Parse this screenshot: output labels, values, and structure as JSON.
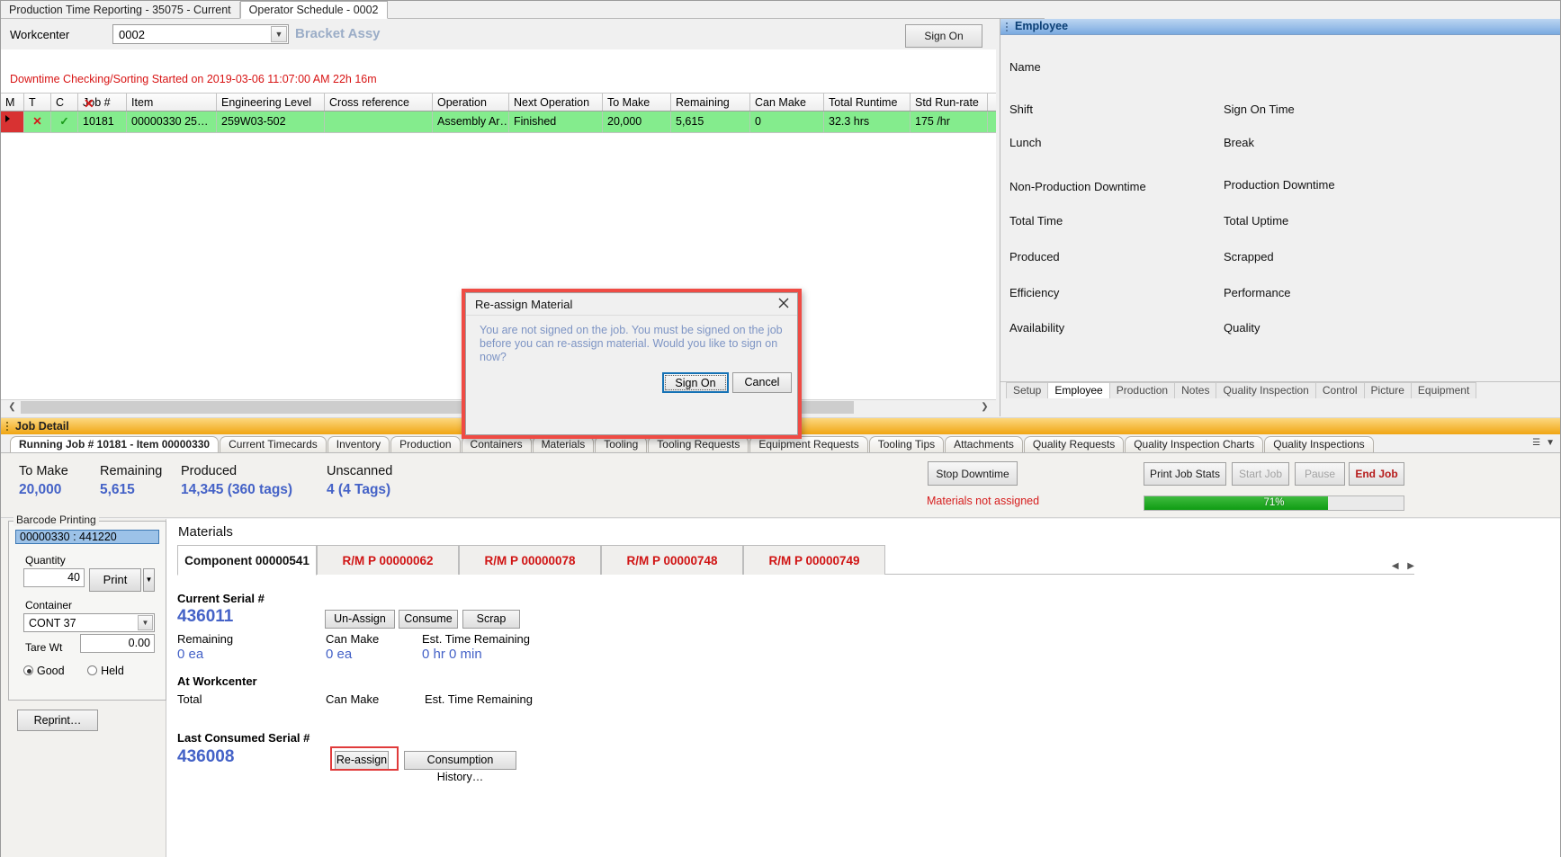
{
  "window": {
    "close_icon": "close-icon"
  },
  "top_tabs": [
    {
      "label": "Production Time Reporting - 35075 - Current",
      "active": false
    },
    {
      "label": "Operator Schedule - 0002",
      "active": true
    }
  ],
  "workcenter": {
    "label": "Workcenter",
    "value": "0002",
    "description": "Bracket Assy",
    "sign_on_button": "Sign On",
    "downtime_message": "Downtime Checking/Sorting Started on 2019-03-06 11:07:00 AM 22h 16m"
  },
  "grid": {
    "columns": [
      "M",
      "T",
      "C",
      "Job #",
      "Item",
      "Engineering Level",
      "Cross reference",
      "Operation",
      "Next Operation",
      "To Make",
      "Remaining",
      "Can Make",
      "Total Runtime",
      "Std Run-rate"
    ],
    "row": {
      "m": "",
      "t": "✕",
      "t2": "✓",
      "c": "✕",
      "job": "10181",
      "item": "00000330  25…",
      "eng_level": "259W03-502",
      "cross_reference": "",
      "operation": "Assembly  Ar…",
      "next_operation": "Finished",
      "to_make": "20,000",
      "remaining": "5,615",
      "can_make": "0",
      "total_runtime": "32.3 hrs",
      "std_run_rate": "175 /hr"
    }
  },
  "employee_panel": {
    "title": "Employee",
    "fields_left": [
      "Name",
      "Shift",
      "Lunch",
      "Non-Production Downtime",
      "Total Time",
      "Produced",
      "Efficiency",
      "Availability"
    ],
    "fields_right": [
      "Sign On Time",
      "Break",
      "Production Downtime",
      "Total Uptime",
      "Scrapped",
      "Performance",
      "Quality"
    ],
    "tabs": [
      {
        "label": "Setup",
        "active": false
      },
      {
        "label": "Employee",
        "active": true
      },
      {
        "label": "Production",
        "active": false
      },
      {
        "label": "Notes",
        "active": false
      },
      {
        "label": "Quality Inspection",
        "active": false
      },
      {
        "label": "Control",
        "active": false
      },
      {
        "label": "Picture",
        "active": false
      },
      {
        "label": "Equipment",
        "active": false
      }
    ]
  },
  "job_detail": {
    "banner": "Job Detail",
    "tabs": [
      {
        "label": "Running Job # 10181 - Item 00000330",
        "active": true
      },
      {
        "label": "Current Timecards",
        "active": false
      },
      {
        "label": "Inventory",
        "active": false
      },
      {
        "label": "Production",
        "active": false
      },
      {
        "label": "Containers",
        "active": false
      },
      {
        "label": "Materials",
        "active": false
      },
      {
        "label": "Tooling",
        "active": false
      },
      {
        "label": "Tooling Requests",
        "active": false
      },
      {
        "label": "Equipment Requests",
        "active": false
      },
      {
        "label": "Tooling Tips",
        "active": false
      },
      {
        "label": "Attachments",
        "active": false
      },
      {
        "label": "Quality Requests",
        "active": false
      },
      {
        "label": "Quality Inspection Charts",
        "active": false
      },
      {
        "label": "Quality Inspections",
        "active": false
      }
    ],
    "tab_nav": {
      "collapse": "☰",
      "next": "▼"
    },
    "stats": [
      {
        "label": "To Make",
        "value": "20,000"
      },
      {
        "label": "Remaining",
        "value": "5,615"
      },
      {
        "label": "Produced",
        "value": "14,345 (360 tags)"
      },
      {
        "label": "Unscanned",
        "value": "4 (4 Tags)"
      }
    ],
    "stop_downtime_button": "Stop Downtime",
    "materials_warning": "Materials not assigned",
    "print_job_stats_button": "Print Job Stats",
    "start_job_button": "Start Job",
    "pause_button": "Pause",
    "end_job_button": "End Job",
    "progress": {
      "percent_label": "71%",
      "percent": 71
    }
  },
  "barcode_printing": {
    "legend": "Barcode Printing",
    "selected_item": "00000330 : 441220",
    "quantity_label": "Quantity",
    "quantity_value": "40",
    "print_button": "Print",
    "print_dropdown_icon": "chevron-down-icon",
    "container_label": "Container",
    "container_value": "CONT 37",
    "tare_wt_label": "Tare Wt",
    "tare_wt_value": "0.00",
    "good_label": "Good",
    "held_label": "Held",
    "good_selected": true,
    "reprint_button": "Reprint…"
  },
  "materials": {
    "title": "Materials",
    "tabs": [
      {
        "label": "Component 00000541",
        "active": true
      },
      {
        "label": "R/M P 00000062",
        "active": false
      },
      {
        "label": "R/M P 00000078",
        "active": false
      },
      {
        "label": "R/M P 00000748",
        "active": false
      },
      {
        "label": "R/M P 00000749",
        "active": false
      }
    ],
    "tabs_nav": {
      "prev": "◀",
      "next": "▶"
    },
    "current_serial_label": "Current Serial #",
    "current_serial_value": "436011",
    "remaining_label": "Remaining",
    "remaining_value": "0 ea",
    "can_make_label": "Can Make",
    "can_make_value": "0 ea",
    "est_time_label": "Est. Time Remaining",
    "est_time_value": "0 hr 0 min",
    "at_workcenter_label": "At Workcenter",
    "total_label": "Total",
    "wc_can_make_label": "Can Make",
    "wc_est_time_label": "Est. Time Remaining",
    "last_consumed_label": "Last Consumed Serial #",
    "last_consumed_value": "436008",
    "unassign_button": "Un-Assign",
    "consume_button": "Consume",
    "scrap_button": "Scrap",
    "reassign_button": "Re-assign",
    "consumption_history_button": "Consumption History…"
  },
  "dialog": {
    "title": "Re-assign Material",
    "close_icon": "close-icon",
    "message": "You are not signed on the job. You must be signed on the job before you can re-assign material. Would you like to sign on now?",
    "sign_on_button": "Sign On",
    "cancel_button": "Cancel"
  },
  "colors": {
    "accent_red": "#d81414",
    "highlight_border": "#ef4b44",
    "row_green": "#84ec8d",
    "value_blue": "#4462c7",
    "banner_orange": "#f0a513"
  }
}
